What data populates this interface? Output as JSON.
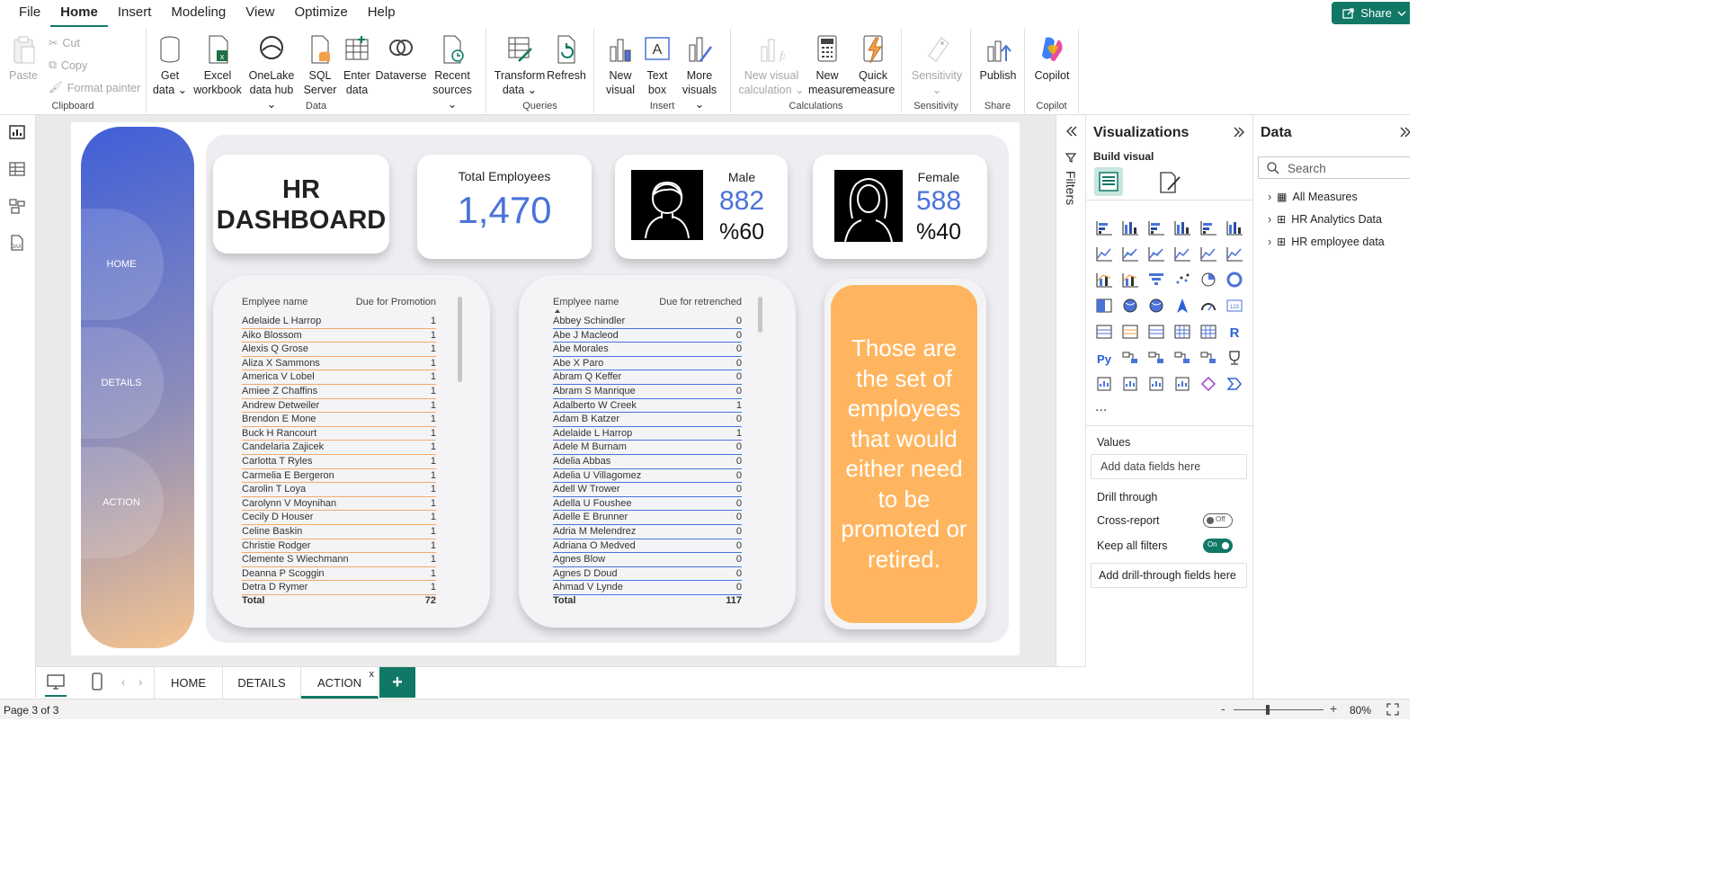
{
  "menu": {
    "items": [
      "File",
      "Home",
      "Insert",
      "Modeling",
      "View",
      "Optimize",
      "Help"
    ],
    "share": "Share"
  },
  "ribbon": {
    "clipboard": {
      "paste": "Paste",
      "cut": "Cut",
      "copy": "Copy",
      "format_painter": "Format painter",
      "label": "Clipboard"
    },
    "data": {
      "label": "Data",
      "get_data": [
        "Get",
        "data"
      ],
      "excel": [
        "Excel",
        "workbook"
      ],
      "onelake": [
        "OneLake",
        "data hub"
      ],
      "sql": [
        "SQL",
        "Server"
      ],
      "enter": [
        "Enter",
        "data"
      ],
      "dataverse": [
        "Dataverse"
      ],
      "recent": [
        "Recent",
        "sources"
      ]
    },
    "queries": {
      "label": "Queries",
      "transform": [
        "Transform",
        "data"
      ],
      "refresh": [
        "Refresh"
      ]
    },
    "insert": {
      "label": "Insert",
      "new_visual": [
        "New",
        "visual"
      ],
      "text_box": [
        "Text",
        "box"
      ],
      "more_visuals": [
        "More",
        "visuals"
      ]
    },
    "calculations": {
      "label": "Calculations",
      "new_visual_calc": [
        "New visual",
        "calculation"
      ],
      "new_measure": [
        "New",
        "measure"
      ],
      "quick_measure": [
        "Quick",
        "measure"
      ]
    },
    "sensitivity": {
      "label": "Sensitivity",
      "btn": [
        "Sensitivity"
      ]
    },
    "share": {
      "label": "Share",
      "publish": [
        "Publish"
      ]
    },
    "copilot": {
      "label": "Copilot",
      "btn": [
        "Copilot"
      ]
    }
  },
  "report": {
    "nav": [
      "HOME",
      "DETAILS",
      "ACTION"
    ],
    "title_lines": [
      "HR",
      "DASHBOARD"
    ],
    "total": {
      "label": "Total Employees",
      "value": "1,470"
    },
    "male": {
      "label": "Male",
      "value": "882",
      "pct": "%60"
    },
    "female": {
      "label": "Female",
      "value": "588",
      "pct": "%40"
    },
    "promo_table": {
      "col1": "Emplyee name",
      "col2": "Due for Promotion",
      "rows": [
        [
          "Adelaide L Harrop",
          "1"
        ],
        [
          "Aiko Blossom",
          "1"
        ],
        [
          "Alexis Q Grose",
          "1"
        ],
        [
          "Aliza X Sammons",
          "1"
        ],
        [
          "America V Lobel",
          "1"
        ],
        [
          "Amiee Z Chaffins",
          "1"
        ],
        [
          "Andrew Detweiler",
          "1"
        ],
        [
          "Brendon E Mone",
          "1"
        ],
        [
          "Buck H Rancourt",
          "1"
        ],
        [
          "Candelaria Zajicek",
          "1"
        ],
        [
          "Carlotta T Ryles",
          "1"
        ],
        [
          "Carmelia E Bergeron",
          "1"
        ],
        [
          "Carolin T Loya",
          "1"
        ],
        [
          "Carolynn V Moynihan",
          "1"
        ],
        [
          "Cecily D Houser",
          "1"
        ],
        [
          "Celine Baskin",
          "1"
        ],
        [
          "Christie Rodger",
          "1"
        ],
        [
          "Clemente S Wiechmann",
          "1"
        ],
        [
          "Deanna P Scoggin",
          "1"
        ],
        [
          "Detra D Rymer",
          "1"
        ]
      ],
      "total_label": "Total",
      "total": "72"
    },
    "retrench_table": {
      "col1": "Emplyee name",
      "col2": "Due for retrenched",
      "rows": [
        [
          "Abbey Schindler",
          "0"
        ],
        [
          "Abe J Macleod",
          "0"
        ],
        [
          "Abe Morales",
          "0"
        ],
        [
          "Abe X Paro",
          "0"
        ],
        [
          "Abram Q Keffer",
          "0"
        ],
        [
          "Abram S Manrique",
          "0"
        ],
        [
          "Adalberto W Creek",
          "1"
        ],
        [
          "Adam B Katzer",
          "0"
        ],
        [
          "Adelaide L Harrop",
          "1"
        ],
        [
          "Adele M Burnam",
          "0"
        ],
        [
          "Adelia Abbas",
          "0"
        ],
        [
          "Adelia U Villagomez",
          "0"
        ],
        [
          "Adell W Trower",
          "0"
        ],
        [
          "Adella U Foushee",
          "0"
        ],
        [
          "Adelle E Brunner",
          "0"
        ],
        [
          "Adria M Melendrez",
          "0"
        ],
        [
          "Adriana O Medved",
          "0"
        ],
        [
          "Agnes Blow",
          "0"
        ],
        [
          "Agnes D Doud",
          "0"
        ],
        [
          "Ahmad V Lynde",
          "0"
        ]
      ],
      "total_label": "Total",
      "total": "117"
    },
    "note": "Those are the set of employees that would either need to be promoted or retired."
  },
  "pages": {
    "tabs": [
      "HOME",
      "DETAILS",
      "ACTION"
    ],
    "active": "ACTION",
    "close": "x",
    "add": "+"
  },
  "status": {
    "page": "Page 3 of 3",
    "zoom": "80%",
    "minus": "-",
    "plus": "+"
  },
  "filters": {
    "label": "Filters"
  },
  "viz": {
    "title": "Visualizations",
    "build": "Build visual",
    "values": "Values",
    "add_fields": "Add data fields here",
    "drill": "Drill through",
    "cross": "Cross-report",
    "cross_state": "Off",
    "keep": "Keep all filters",
    "keep_state": "On",
    "add_drill": "Add drill-through fields here",
    "more": "..."
  },
  "data_pane": {
    "title": "Data",
    "search": "Search",
    "items": [
      "All Measures",
      "HR Analytics Data",
      "HR employee data"
    ]
  },
  "colors": {
    "accent": "#117865",
    "orange": "#ffb55f",
    "blue": "#4a73d8",
    "promo_line": "#f3a96b",
    "retrench_line": "#4a73d8"
  }
}
